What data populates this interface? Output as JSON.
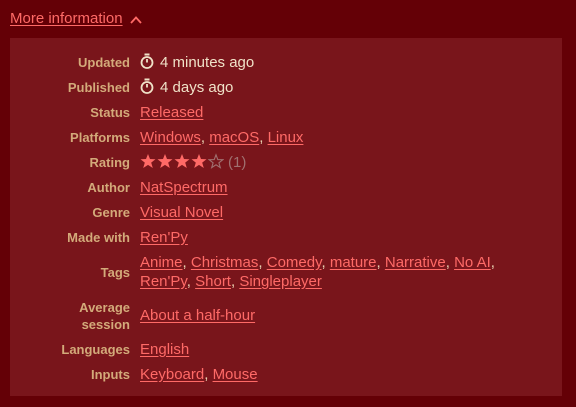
{
  "toggle": {
    "label": "More information"
  },
  "rows": {
    "updated": {
      "label": "Updated",
      "value": "4 minutes ago"
    },
    "published": {
      "label": "Published",
      "value": "4 days ago"
    },
    "status": {
      "label": "Status",
      "value": "Released"
    },
    "platforms": {
      "label": "Platforms",
      "items": [
        "Windows",
        "macOS",
        "Linux"
      ]
    },
    "rating": {
      "label": "Rating",
      "stars_filled": 4,
      "stars_total": 5,
      "count": "(1)"
    },
    "author": {
      "label": "Author",
      "value": "NatSpectrum"
    },
    "genre": {
      "label": "Genre",
      "value": "Visual Novel"
    },
    "made_with": {
      "label": "Made with",
      "value": "Ren'Py"
    },
    "tags": {
      "label": "Tags",
      "items": [
        "Anime",
        "Christmas",
        "Comedy",
        "mature",
        "Narrative",
        "No AI",
        "Ren'Py",
        "Short",
        "Singleplayer"
      ]
    },
    "session": {
      "label_line1": "Average",
      "label_line2": "session",
      "value": "About a half-hour"
    },
    "languages": {
      "label": "Languages",
      "value": "English"
    },
    "inputs": {
      "label": "Inputs",
      "items": [
        "Keyboard",
        "Mouse"
      ]
    }
  },
  "colors": {
    "background": "#640006",
    "panel": "#79151b",
    "link": "#ff6a67",
    "label": "#d3aa7a",
    "star_filled": "#ff6a67"
  },
  "icons": {
    "time": "stopwatch-icon",
    "toggle": "chevron-up-icon",
    "star_filled": "star-filled-icon",
    "star_empty": "star-empty-icon"
  }
}
